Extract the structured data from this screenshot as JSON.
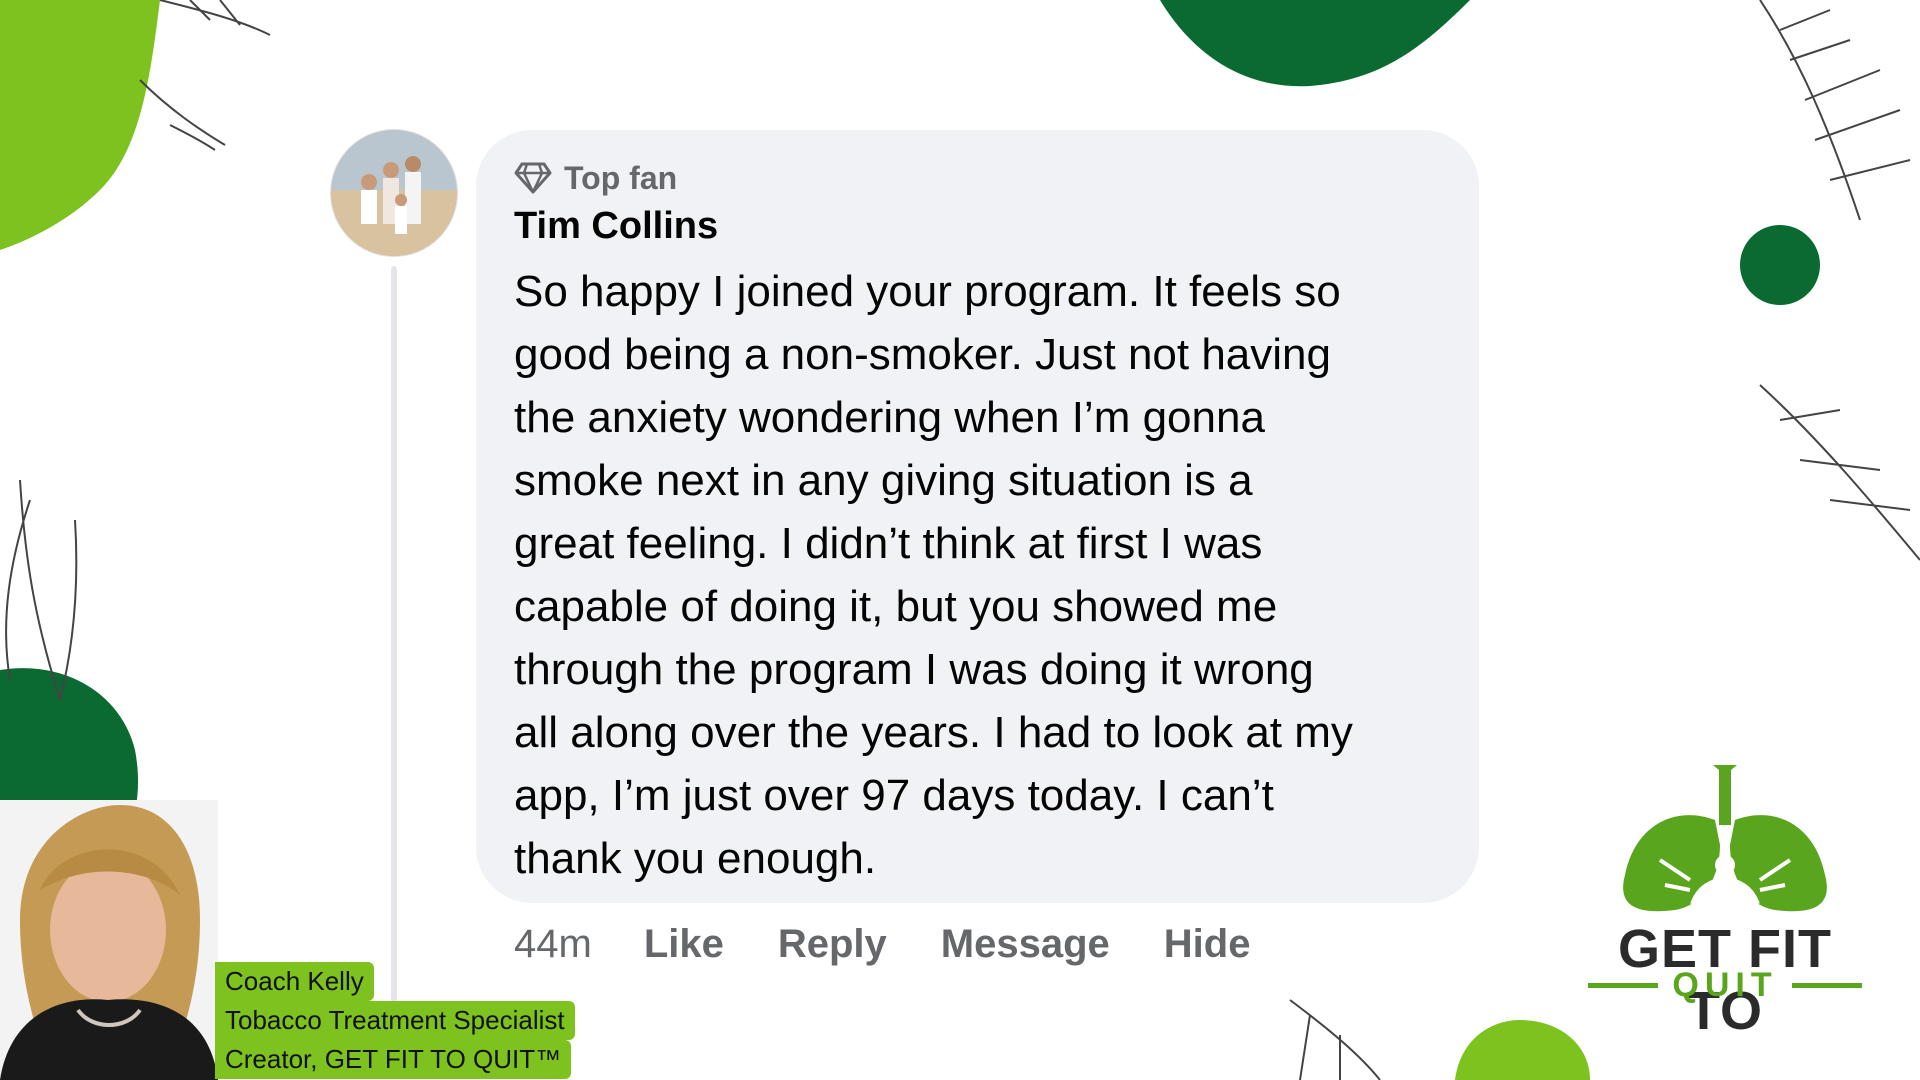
{
  "comment": {
    "badge_label": "Top fan",
    "badge_icon": "diamond-icon",
    "author": "Tim Collins",
    "text": "So happy I joined your program. It feels so\ngood being a non-smoker.  Just not having\nthe anxiety wondering when I’m gonna\nsmoke next in any giving situation is a\ngreat feeling. I didn’t think at first I was\ncapable of doing it, but you showed me\nthrough the program I was doing it wrong\nall along over the years.  I had to look at my\napp, I’m just over 97 days today. I can’t\nthank you enough.",
    "time": "44m",
    "actions": {
      "like": "Like",
      "reply": "Reply",
      "message": "Message",
      "hide": "Hide"
    }
  },
  "coach_caption": {
    "line1": "Coach Kelly",
    "line2": "Tobacco Treatment Specialist",
    "line3": "Creator, GET FIT TO QUIT™"
  },
  "brand": {
    "logo_main": "GET FIT TO",
    "logo_sub": "QUIT",
    "colors": {
      "light_green": "#7dc21e",
      "dark_green": "#0b6a32",
      "bubble_gray": "#f0f2f5",
      "secondary_text": "#65676b"
    }
  }
}
